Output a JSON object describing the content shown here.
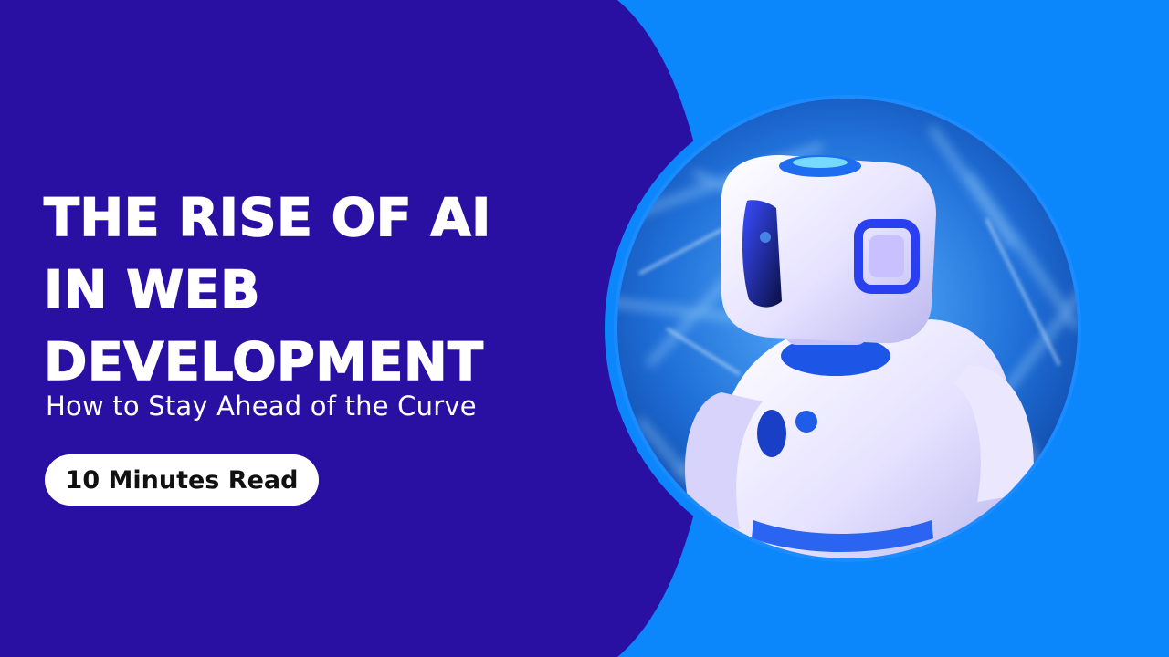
{
  "title_lines": [
    "THE RISE OF AI",
    "IN WEB",
    "DEVELOPMENT"
  ],
  "subtitle": "How to Stay Ahead of the Curve",
  "badge": "10 Minutes Read",
  "colors": {
    "left_panel": "#2a10a2",
    "right_panel": "#0b87fb",
    "text": "#ffffff",
    "badge_bg": "#ffffff",
    "badge_text": "#111111"
  },
  "image": {
    "subject": "white toy robot with blue accents against blurred blue background",
    "icon": "robot-photo"
  }
}
